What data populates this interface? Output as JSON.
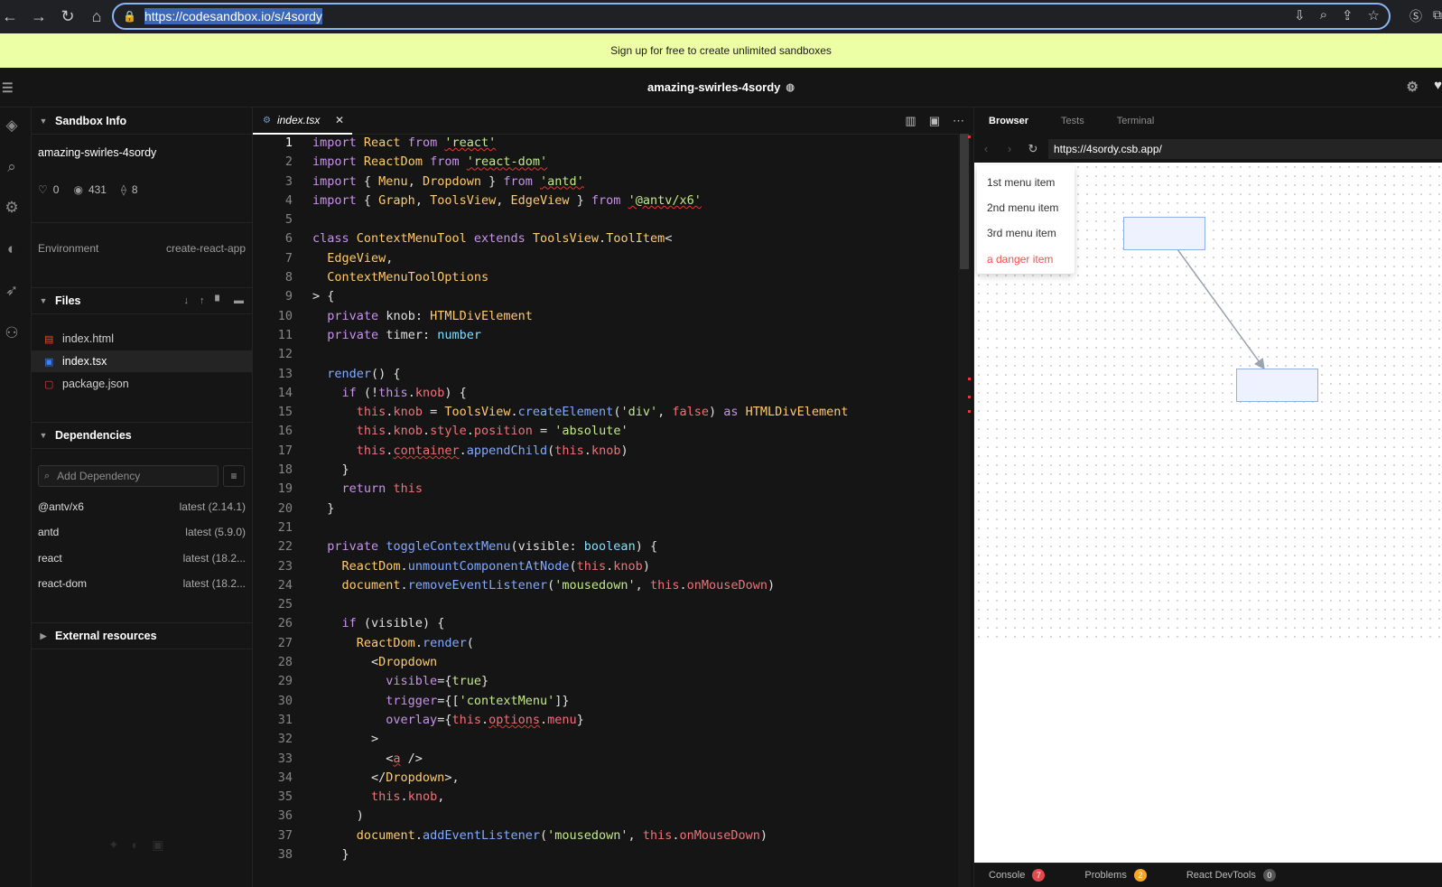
{
  "browser": {
    "url": "https://codesandbox.io/s/4sordy"
  },
  "banner": {
    "text": "Sign up for free to create unlimited sandboxes"
  },
  "header": {
    "title": "amazing-swirles-4sordy"
  },
  "sidebar": {
    "info_title": "Sandbox Info",
    "sandbox_name": "amazing-swirles-4sordy",
    "likes": "0",
    "views": "431",
    "forks": "8",
    "env_label": "Environment",
    "env_value": "create-react-app",
    "files_title": "Files",
    "files": [
      {
        "name": "index.html"
      },
      {
        "name": "index.tsx"
      },
      {
        "name": "package.json"
      }
    ],
    "deps_title": "Dependencies",
    "dep_placeholder": "Add Dependency",
    "dependencies": [
      {
        "name": "@antv/x6",
        "version": "latest (2.14.1)"
      },
      {
        "name": "antd",
        "version": "latest (5.9.0)"
      },
      {
        "name": "react",
        "version": "latest (18.2..."
      },
      {
        "name": "react-dom",
        "version": "latest (18.2..."
      }
    ],
    "external_title": "External resources"
  },
  "editor": {
    "tab_label": "index.tsx",
    "line_numbers": [
      "1",
      "2",
      "3",
      "4",
      "5",
      "6",
      "7",
      "8",
      "9",
      "10",
      "11",
      "12",
      "13",
      "14",
      "15",
      "16",
      "17",
      "18",
      "19",
      "20",
      "21",
      "22",
      "23",
      "24",
      "25",
      "26",
      "27",
      "28",
      "29",
      "30",
      "31",
      "32",
      "33",
      "34",
      "35",
      "36",
      "37",
      "38"
    ],
    "tok": {
      "import": "import",
      "from": "from",
      "class": "class",
      "extends": "extends",
      "private": "private",
      "if": "if",
      "return": "return",
      "as": "as",
      "this": "this",
      "false": "false",
      "true": "true",
      "number": "number",
      "boolean": "boolean",
      "react": "'react'",
      "react_dom": "'react-dom'",
      "antd": "'antd'",
      "x6": "'@antv/x6'",
      "div": "'div'",
      "absolute": "'absolute'",
      "mousedown": "'mousedown'",
      "contextMenu": "'contextMenu'",
      "React": "React",
      "ReactDom": "ReactDom",
      "Menu": "Menu",
      "Dropdown": "Dropdown",
      "Graph": "Graph",
      "ToolsView": "ToolsView",
      "EdgeView": "EdgeView",
      "ContextMenuTool": "ContextMenuTool",
      "ToolItem": "ToolItem",
      "ContextMenuToolOptions": "ContextMenuToolOptions",
      "HTMLDivElement": "HTMLDivElement",
      "knob": "knob",
      "timer": "timer",
      "render": "render",
      "createElement": "createElement",
      "style": "style",
      "position": "position",
      "container": "container",
      "appendChild": "appendChild",
      "toggleContextMenu": "toggleContextMenu",
      "visible": "visible",
      "unmountComponentAtNode": "unmountComponentAtNode",
      "document": "document",
      "removeEventListener": "removeEventListener",
      "addEventListener": "addEventListener",
      "onMouseDown": "onMouseDown",
      "trigger": "trigger",
      "overlay": "overlay",
      "options": "options",
      "menu": "menu",
      "a": "a"
    }
  },
  "preview": {
    "tab_browser": "Browser",
    "tab_tests": "Tests",
    "tab_terminal": "Terminal",
    "url": "https://4sordy.csb.app/",
    "menu_items": [
      "1st menu item",
      "2nd menu item",
      "3rd menu item"
    ],
    "danger_item": "a danger item",
    "console_label": "Console",
    "console_count": "7",
    "problems_label": "Problems",
    "problems_count": "2",
    "devtools_label": "React DevTools",
    "devtools_count": "0",
    "colors": {
      "console_badge": "#e5484d",
      "problems_badge": "#f5a623",
      "devtools_badge": "#555555"
    }
  }
}
